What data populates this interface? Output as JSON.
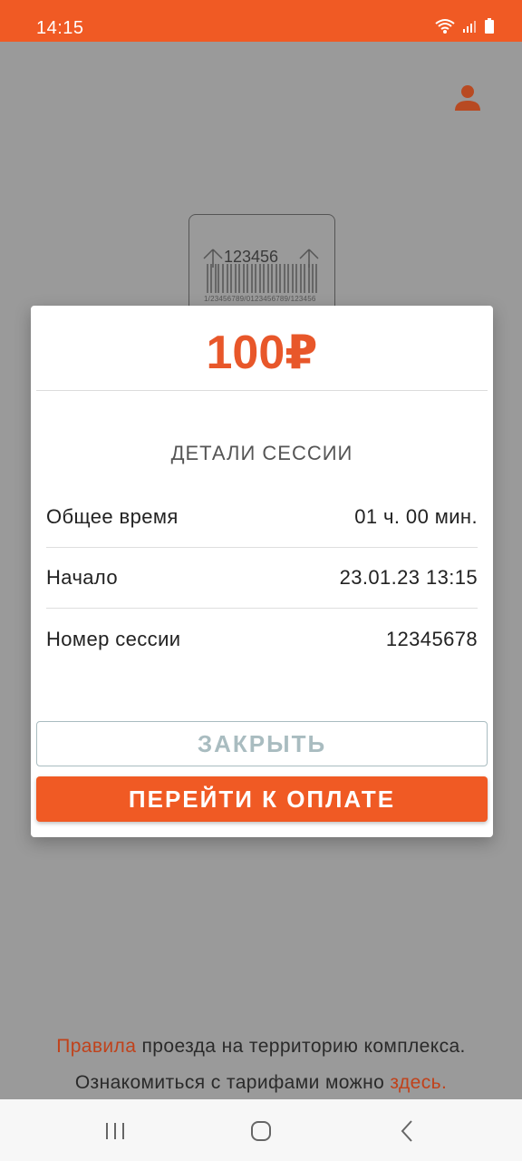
{
  "status_bar": {
    "time": "14:15",
    "icons": [
      "wifi-icon",
      "signal-icon",
      "battery-icon"
    ]
  },
  "background": {
    "ticket_number": "123456",
    "ticket_barcode_text": "1/23456789/0123456789/123456",
    "footer": {
      "rules_link": "Правила",
      "rules_text": " проезда на территорию комплекса.",
      "tariffs_text": "Ознакомиться с тарифами можно ",
      "tariffs_link": "здесь."
    }
  },
  "modal": {
    "amount": "100₽",
    "section_title": "ДЕТАЛИ СЕССИИ",
    "rows": [
      {
        "label": "Общее время",
        "value": "01 ч. 00 мин."
      },
      {
        "label": "Начало",
        "value": "23.01.23 13:15"
      },
      {
        "label": "Номер сессии",
        "value": "12345678"
      }
    ],
    "close_label": "ЗАКРЫТЬ",
    "pay_label": "ПЕРЕЙТИ К ОПЛАТЕ"
  },
  "nav_bar": {
    "icons": [
      "recent-apps-icon",
      "home-icon",
      "back-icon"
    ]
  },
  "colors": {
    "accent": "#f05a24",
    "link": "#c0421b",
    "close_border": "#a9bcc0"
  }
}
